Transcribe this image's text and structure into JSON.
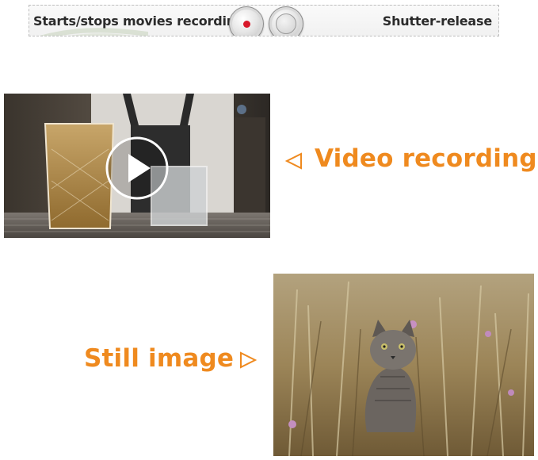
{
  "controls": {
    "movie_label": "Starts/stops movies recording",
    "shutter_label": "Shutter-release",
    "record_color": "#d8192a"
  },
  "captions": {
    "video": "Video recording",
    "still": "Still image",
    "accent_color": "#ef8a1f"
  },
  "icons": {
    "video": "play-icon",
    "left_pointer": "triangle-left-icon",
    "right_pointer": "triangle-right-icon"
  }
}
